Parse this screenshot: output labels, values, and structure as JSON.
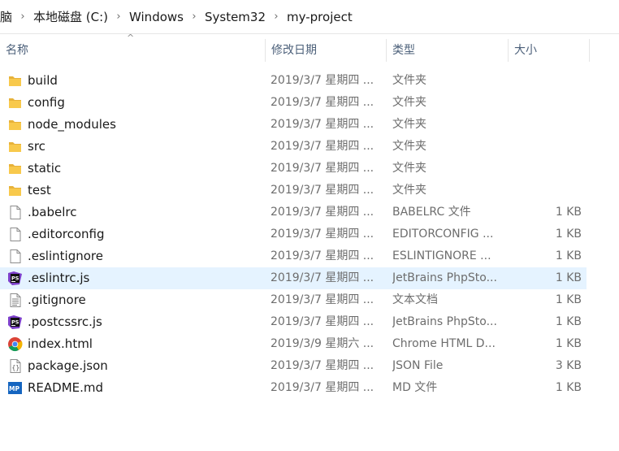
{
  "breadcrumb": [
    "脑",
    "本地磁盘 (C:)",
    "Windows",
    "System32",
    "my-project"
  ],
  "columns": {
    "name": "名称",
    "date": "修改日期",
    "type": "类型",
    "size": "大小"
  },
  "files": [
    {
      "name": "build",
      "date": "2019/3/7 星期四 ...",
      "type": "文件夹",
      "size": "",
      "icon": "folder-icon"
    },
    {
      "name": "config",
      "date": "2019/3/7 星期四 ...",
      "type": "文件夹",
      "size": "",
      "icon": "folder-icon"
    },
    {
      "name": "node_modules",
      "date": "2019/3/7 星期四 ...",
      "type": "文件夹",
      "size": "",
      "icon": "folder-icon"
    },
    {
      "name": "src",
      "date": "2019/3/7 星期四 ...",
      "type": "文件夹",
      "size": "",
      "icon": "folder-icon"
    },
    {
      "name": "static",
      "date": "2019/3/7 星期四 ...",
      "type": "文件夹",
      "size": "",
      "icon": "folder-icon"
    },
    {
      "name": "test",
      "date": "2019/3/7 星期四 ...",
      "type": "文件夹",
      "size": "",
      "icon": "folder-icon"
    },
    {
      "name": ".babelrc",
      "date": "2019/3/7 星期四 ...",
      "type": "BABELRC 文件",
      "size": "1 KB",
      "icon": "file-icon"
    },
    {
      "name": ".editorconfig",
      "date": "2019/3/7 星期四 ...",
      "type": "EDITORCONFIG ...",
      "size": "1 KB",
      "icon": "file-icon"
    },
    {
      "name": ".eslintignore",
      "date": "2019/3/7 星期四 ...",
      "type": "ESLINTIGNORE ...",
      "size": "1 KB",
      "icon": "file-icon"
    },
    {
      "name": ".eslintrc.js",
      "date": "2019/3/7 星期四 ...",
      "type": "JetBrains PhpSto...",
      "size": "1 KB",
      "icon": "phpstorm-icon",
      "selected": true
    },
    {
      "name": ".gitignore",
      "date": "2019/3/7 星期四 ...",
      "type": "文本文档",
      "size": "1 KB",
      "icon": "text-file-icon"
    },
    {
      "name": ".postcssrc.js",
      "date": "2019/3/7 星期四 ...",
      "type": "JetBrains PhpSto...",
      "size": "1 KB",
      "icon": "phpstorm-icon"
    },
    {
      "name": "index.html",
      "date": "2019/3/9 星期六 ...",
      "type": "Chrome HTML D...",
      "size": "1 KB",
      "icon": "chrome-icon"
    },
    {
      "name": "package.json",
      "date": "2019/3/7 星期四 ...",
      "type": "JSON File",
      "size": "3 KB",
      "icon": "json-file-icon"
    },
    {
      "name": "README.md",
      "date": "2019/3/7 星期四 ...",
      "type": "MD 文件",
      "size": "1 KB",
      "icon": "markdown-icon"
    }
  ],
  "colors": {
    "folder": "#f8c94c",
    "selected_row": "#e5f3ff",
    "header_text": "#4c607a",
    "phpstorm": "#7c3fc9",
    "markdown": "#1565c0"
  }
}
